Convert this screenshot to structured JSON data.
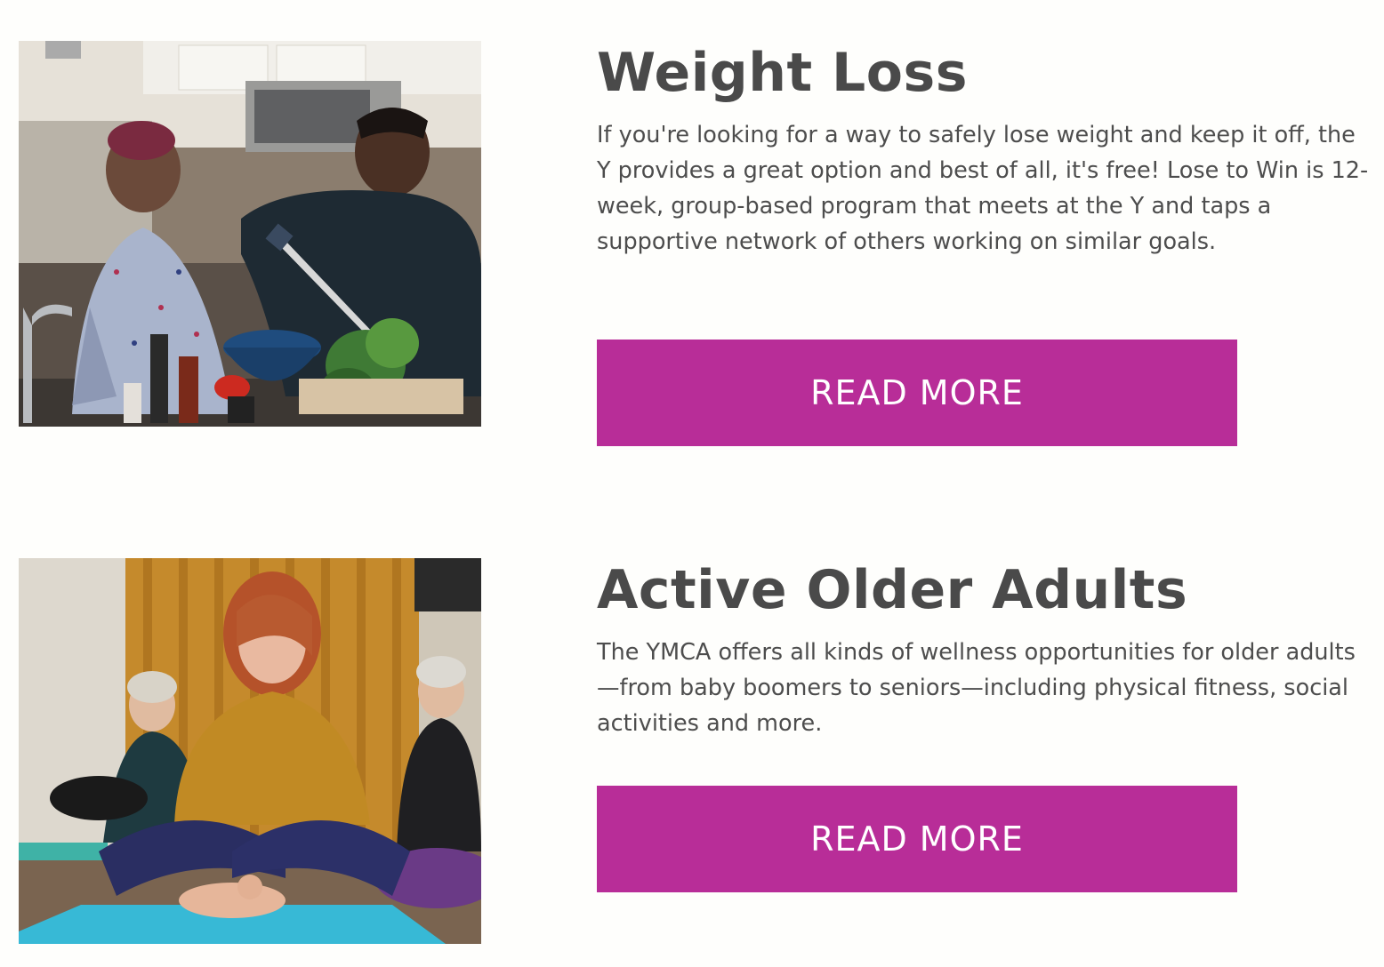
{
  "programs": [
    {
      "title": "Weight Loss",
      "description": "If you're looking for a way to safely lose weight and keep it off, the Y provides a great option and best of all, it's free! Lose to Win is 12-week, group-based program that meets at the Y and taps a supportive network of others working on similar goals.",
      "button_label": "READ MORE"
    },
    {
      "title": "Active Older Adults",
      "description": "The YMCA offers all kinds of wellness opportunities for older adults—from baby boomers to seniors—including physical fitness, social activities and more.",
      "button_label": "READ MORE"
    }
  ],
  "colors": {
    "button_bg": "#b82d98",
    "button_text": "#ffffff",
    "heading_text": "#4a4a4a",
    "body_text": "#4d4d4d",
    "page_bg": "#fefefc"
  }
}
